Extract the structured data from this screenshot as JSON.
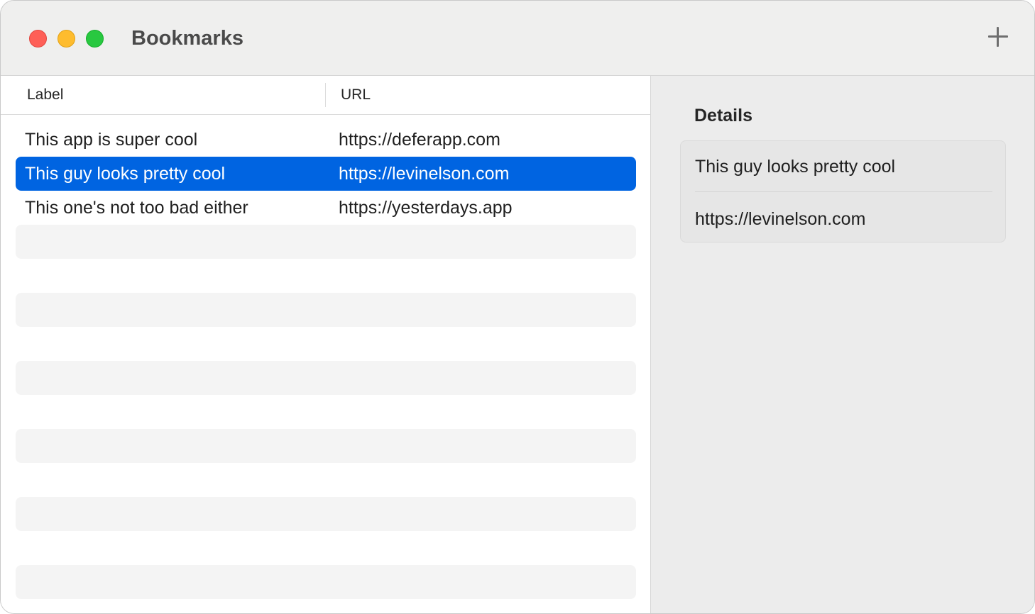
{
  "window": {
    "title": "Bookmarks"
  },
  "toolbar": {
    "add_icon": "plus-icon"
  },
  "table": {
    "columns": [
      "Label",
      "URL"
    ],
    "rows": [
      {
        "label": "This app is super cool",
        "url": "https://deferapp.com"
      },
      {
        "label": "This guy looks pretty cool",
        "url": "https://levinelson.com"
      },
      {
        "label": "This one's not too bad either",
        "url": "https://yesterdays.app"
      }
    ],
    "selected_index": 1
  },
  "details": {
    "title": "Details",
    "label": "This guy looks pretty cool",
    "url": "https://levinelson.com"
  },
  "colors": {
    "accent": "#0064e1",
    "close": "#fe5f57",
    "minimize": "#febc2e",
    "zoom": "#28c840"
  }
}
